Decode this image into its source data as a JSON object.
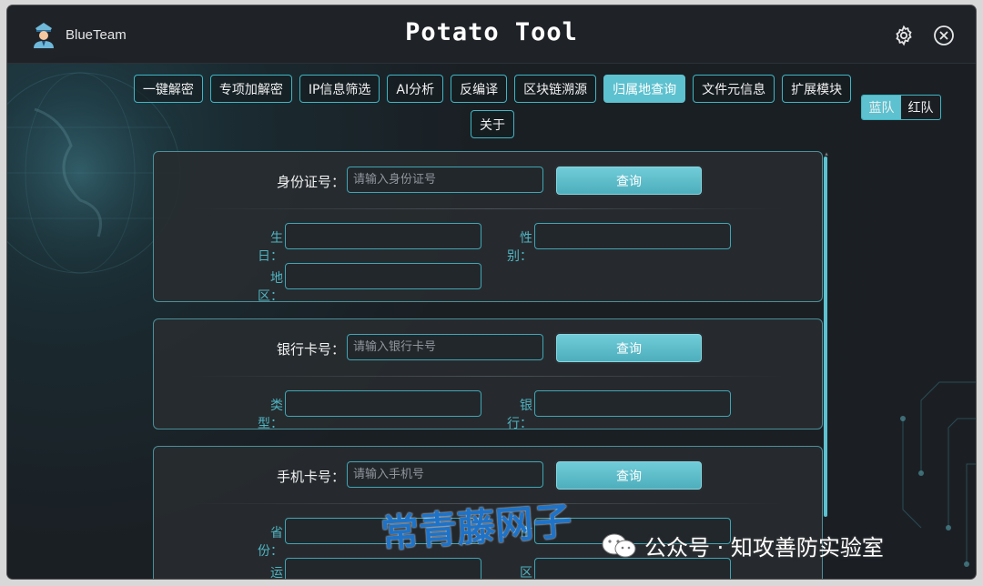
{
  "titlebar": {
    "brand": "BlueTeam",
    "title": "Potato Tool",
    "settings_icon": "gear-icon",
    "close_icon": "close-circle-icon"
  },
  "tabs": [
    {
      "label": "一键解密"
    },
    {
      "label": "专项加解密"
    },
    {
      "label": "IP信息筛选"
    },
    {
      "label": "AI分析"
    },
    {
      "label": "反编译"
    },
    {
      "label": "区块链溯源"
    },
    {
      "label": "归属地查询",
      "active": true
    },
    {
      "label": "文件元信息"
    },
    {
      "label": "扩展模块"
    },
    {
      "label": "关于"
    }
  ],
  "team_switch": {
    "blue": "蓝队",
    "red": "红队",
    "selected": "blue"
  },
  "id_card": {
    "label": "身份证号：",
    "placeholder": "请输入身份证号",
    "query": "查询",
    "birthday_label": "生日：",
    "gender_label": "性别：",
    "region_label": "地区："
  },
  "bank_card": {
    "label": "银行卡号：",
    "placeholder": "请输入银行卡号",
    "query": "查询",
    "type_label": "类型：",
    "bank_label": "银行："
  },
  "phone": {
    "label": "手机卡号：",
    "placeholder": "请输入手机号",
    "query": "查询",
    "province_label": "省份：",
    "city_label": "市",
    "carrier_label": "运商：",
    "areacode_label": "区号："
  },
  "watermark": {
    "text": "常青藤网子",
    "wechat": "公众号 · 知攻善防实验室"
  },
  "colors": {
    "accent": "#5dc1cf",
    "border": "#3fb6c4",
    "bg": "#1d2126"
  }
}
